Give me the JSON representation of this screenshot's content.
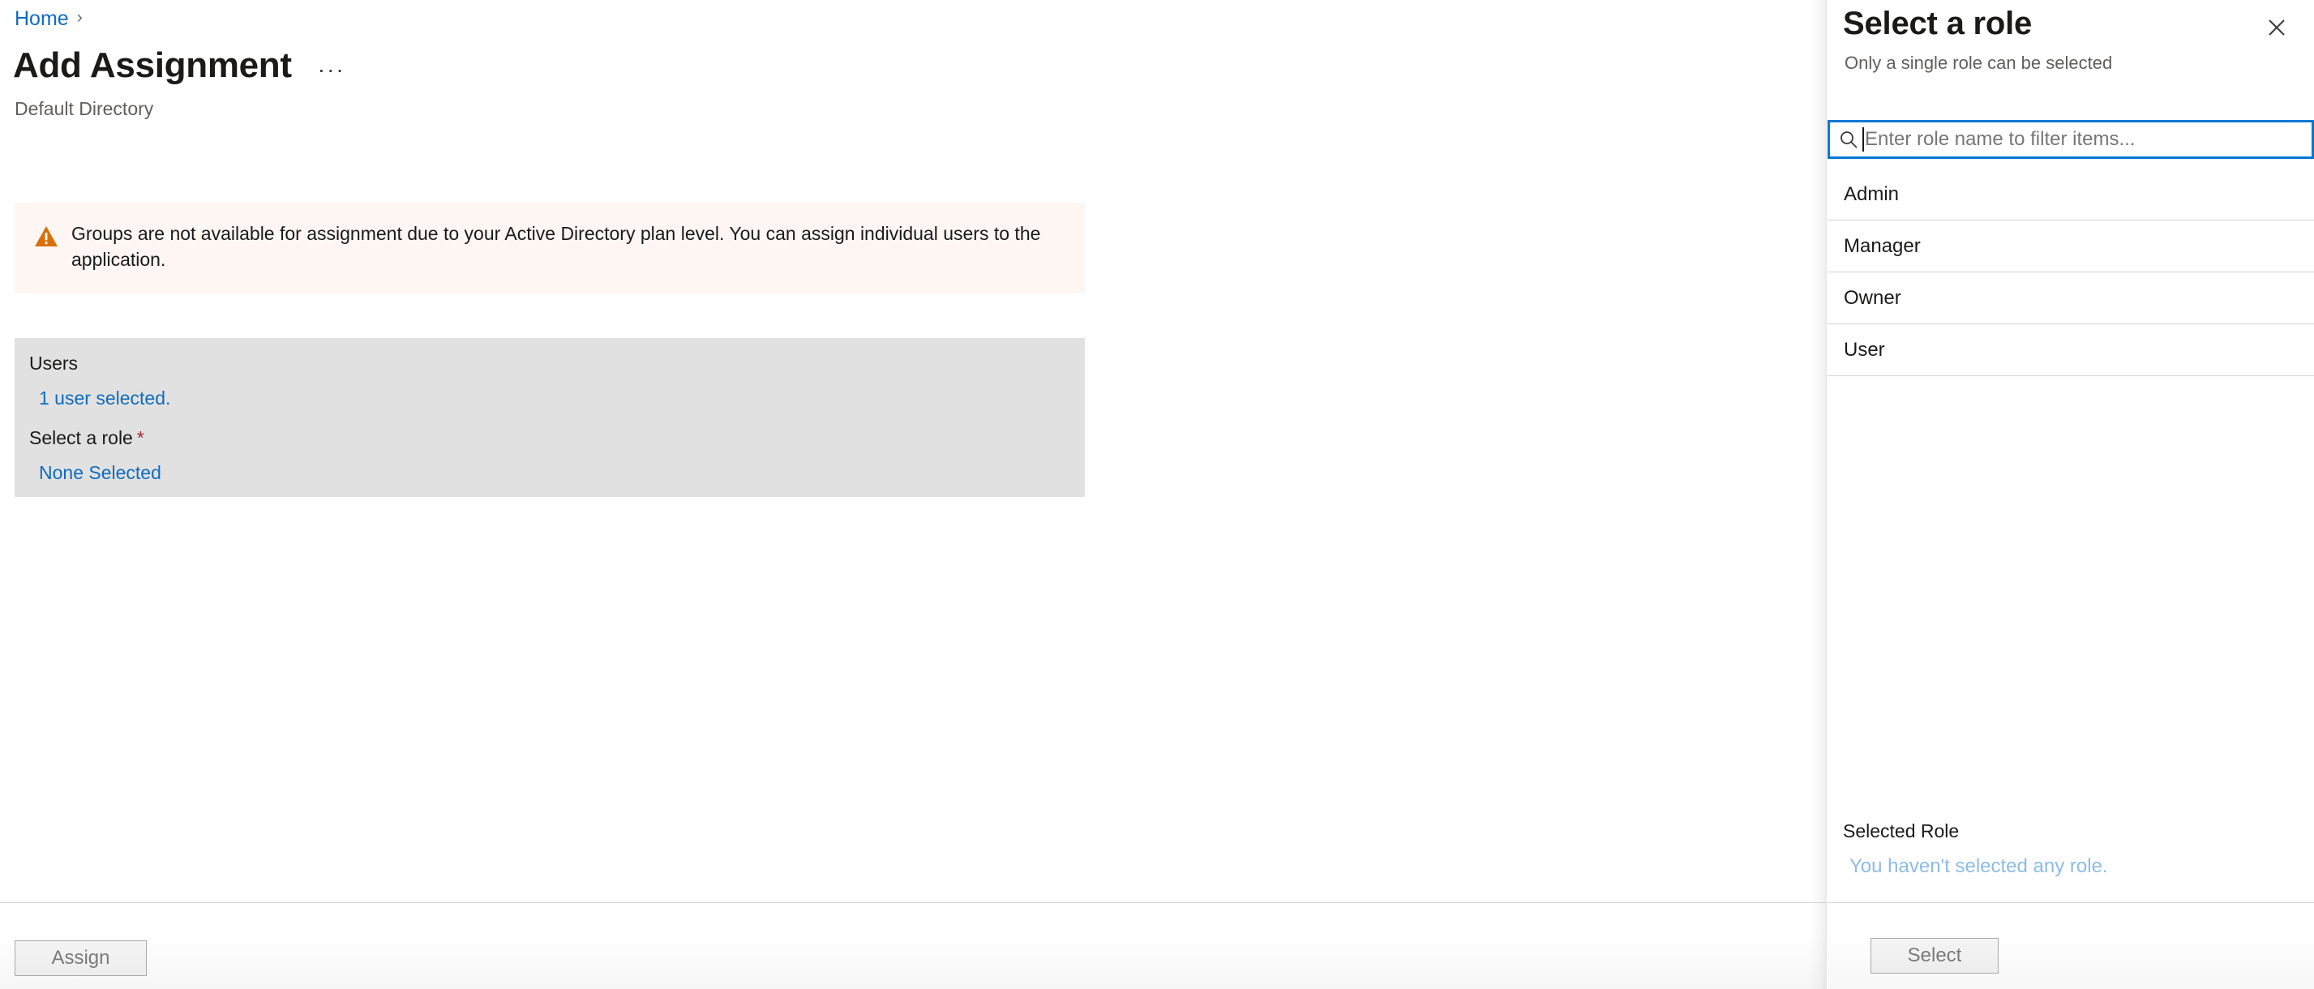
{
  "breadcrumb": {
    "home_label": "Home",
    "chevron": "›"
  },
  "header": {
    "title": "Add Assignment",
    "subtitle": "Default Directory",
    "more_label": "···"
  },
  "warning": {
    "icon": "warning-triangle-icon",
    "message": "Groups are not available for assignment due to your Active Directory plan level. You can assign individual users to the application.",
    "background": "#fdf6f3",
    "icon_color": "#d83b01"
  },
  "form": {
    "background": "#e1e1e1",
    "users_label": "Users",
    "users_value": "1 user selected.",
    "role_label": "Select a role",
    "role_required_marker": "*",
    "role_value": "None Selected",
    "link_color": "#0f6cbd",
    "required_color": "#a4262c"
  },
  "footer": {
    "assign_label": "Assign"
  },
  "pane": {
    "title": "Select a role",
    "subtitle": "Only a single role can be selected",
    "close_icon": "close-icon",
    "search": {
      "icon": "search-icon",
      "value": "",
      "placeholder": "Enter role name to filter items...",
      "focus_border_color": "#0078d4"
    },
    "roles": [
      {
        "label": "Admin"
      },
      {
        "label": "Manager"
      },
      {
        "label": "Owner"
      },
      {
        "label": "User"
      }
    ],
    "selected_role_label": "Selected Role",
    "selected_role_value": "You haven't selected any role.",
    "selected_role_value_color": "#8cbbe8",
    "select_button_label": "Select"
  }
}
